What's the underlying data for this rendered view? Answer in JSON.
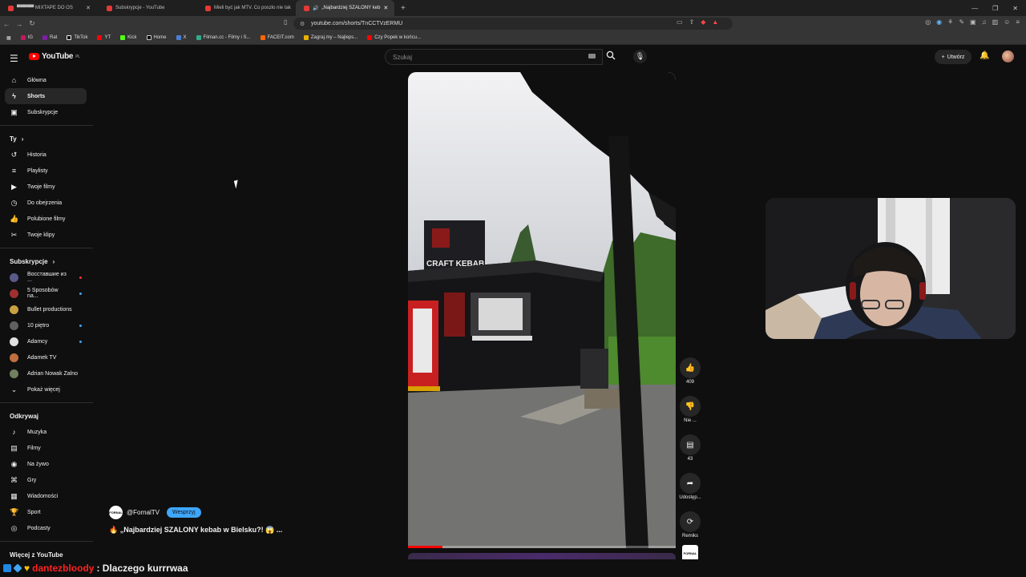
{
  "browser": {
    "tabs": [
      {
        "title": "▀▀▀▀▀ MIXTAPE DO OS",
        "active": false
      },
      {
        "title": "Subskrypcje - YouTube",
        "active": false
      },
      {
        "title": "Mieli być jak MTV. Co poszło nie tak",
        "active": false
      },
      {
        "title": "„Najbardziej SZALONY keb",
        "active": true
      }
    ],
    "url": "youtube.com/shorts/TnCCTVzERMU",
    "bookmarks": [
      "IG",
      "Rat",
      "TikTok",
      "YT",
      "Kick",
      "Home",
      "X",
      "Filman.cc - Filmy i S...",
      "FACEIT.com",
      "Zagraj.my – Najleps...",
      "Czy Popek w końcu..."
    ]
  },
  "header": {
    "logo_text": "YouTube",
    "logo_region": "PL",
    "search_placeholder": "Szukaj",
    "create_label": "Utwórz"
  },
  "sidebar": {
    "main": [
      {
        "label": "Główna",
        "icon": "home-icon",
        "active": false
      },
      {
        "label": "Shorts",
        "icon": "shorts-icon",
        "active": true
      },
      {
        "label": "Subskrypcje",
        "icon": "subscriptions-icon",
        "active": false
      }
    ],
    "you_heading": "Ty",
    "you": [
      {
        "label": "Historia",
        "icon": "history-icon"
      },
      {
        "label": "Playlisty",
        "icon": "playlist-icon"
      },
      {
        "label": "Twoje filmy",
        "icon": "your-videos-icon"
      },
      {
        "label": "Do obejrzenia",
        "icon": "watch-later-icon"
      },
      {
        "label": "Polubione filmy",
        "icon": "liked-icon"
      },
      {
        "label": "Twoje klipy",
        "icon": "clips-icon"
      }
    ],
    "subs_heading": "Subskrypcje",
    "subs": [
      {
        "label": "Восставшие из ...",
        "color": "#5a5a8a",
        "live": true
      },
      {
        "label": "5 Sposobów na...",
        "color": "#a03030",
        "live": true
      },
      {
        "label": "Bullet productions",
        "color": "#c8a040",
        "live": false
      },
      {
        "label": "10 piętro",
        "color": "#606060",
        "live": true
      },
      {
        "label": "Adamcy",
        "color": "#e0e0e0",
        "live": true
      },
      {
        "label": "Adamek TV",
        "color": "#c07040",
        "live": false
      },
      {
        "label": "Adrian Nowak Zalno",
        "color": "#708060",
        "live": false
      }
    ],
    "show_more": "Pokaż więcej",
    "explore_heading": "Odkrywaj",
    "explore": [
      {
        "label": "Muzyka",
        "icon": "music-icon"
      },
      {
        "label": "Filmy",
        "icon": "film-icon"
      },
      {
        "label": "Na żywo",
        "icon": "live-icon"
      },
      {
        "label": "Gry",
        "icon": "gaming-icon"
      },
      {
        "label": "Wiadomości",
        "icon": "news-icon"
      },
      {
        "label": "Sport",
        "icon": "trophy-icon"
      },
      {
        "label": "Podcasty",
        "icon": "podcast-icon"
      }
    ],
    "more_heading": "Więcej z YouTube"
  },
  "short": {
    "channel": "@FornalTV",
    "support_label": "Wesprzyj",
    "title": "🔥 „Najbardziej SZALONY kebab w Bielsku?! 😱 ...",
    "sign_text": "CRAFT KEBAB",
    "progress": 0.13,
    "likes": "409",
    "dislike_label": "Nie ...",
    "comments": "43",
    "share_label": "Udostęp...",
    "remix_label": "Remiks",
    "channel_thumb_text": "FORNAL"
  },
  "chat": {
    "username": "dantezbloody",
    "message": ": Dlaczego kurrrwaa"
  }
}
